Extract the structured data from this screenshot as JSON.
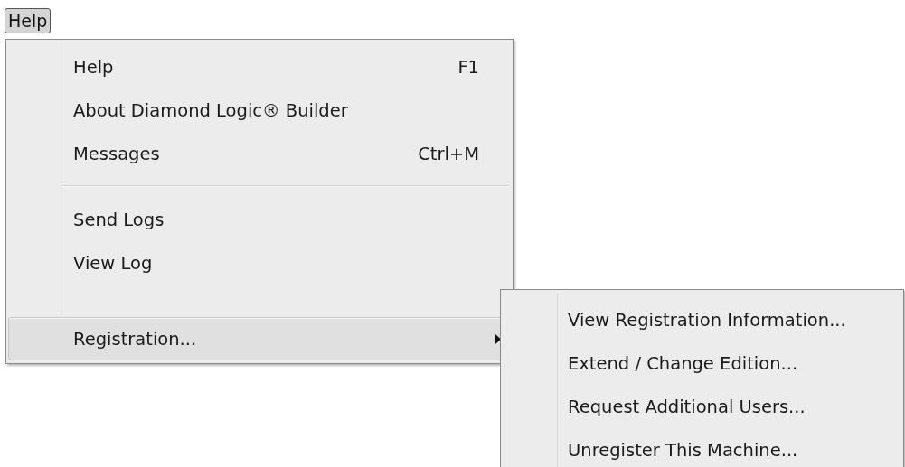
{
  "menu_bar": [
    {
      "label": "Help",
      "selected": true
    }
  ],
  "menu": {
    "items": [
      {
        "kind": "item",
        "label": "Help",
        "shortcut": "F1",
        "selected": false
      },
      {
        "kind": "item",
        "label": "About Diamond Logic® Builder",
        "selected": false
      },
      {
        "kind": "item",
        "label": "Messages",
        "shortcut": "Ctrl+M",
        "selected": false
      },
      {
        "kind": "separator"
      },
      {
        "kind": "item",
        "label": "Send Logs",
        "selected": false
      },
      {
        "kind": "item",
        "label": "View Log",
        "selected": false
      },
      {
        "kind": "blank"
      },
      {
        "kind": "submenu",
        "label": "Registration...",
        "selected": true
      }
    ]
  },
  "submenu": {
    "items": [
      {
        "kind": "item",
        "label": "View Registration Information...",
        "selected": false
      },
      {
        "kind": "item",
        "label": "Extend / Change Edition...",
        "selected": false
      },
      {
        "kind": "item",
        "label": "Request Additional Users...",
        "selected": false
      },
      {
        "kind": "item",
        "label": "Unregister This Machine...",
        "selected": false
      }
    ]
  }
}
